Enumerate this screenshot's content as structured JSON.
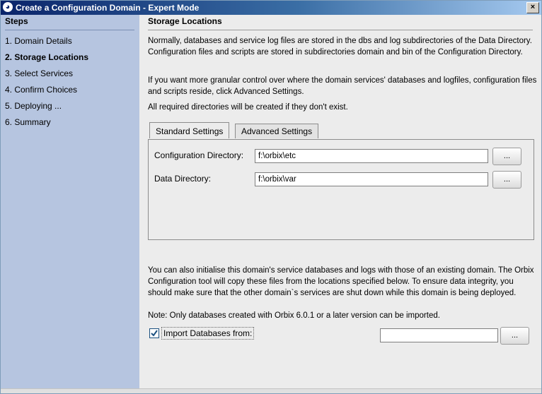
{
  "window": {
    "title": "Create a Configuration Domain - Expert Mode",
    "close_label": "×"
  },
  "sidebar": {
    "header": "Steps",
    "items": [
      {
        "label": "1. Domain Details",
        "active": false
      },
      {
        "label": "2. Storage Locations",
        "active": true
      },
      {
        "label": "3. Select Services",
        "active": false
      },
      {
        "label": "4. Confirm Choices",
        "active": false
      },
      {
        "label": "5. Deploying ...",
        "active": false
      },
      {
        "label": "6. Summary",
        "active": false
      }
    ]
  },
  "main": {
    "title": "Storage Locations",
    "para1": "Normally, databases and service log files are stored in the dbs and log subdirectories of the Data Directory. Configuration files and scripts are stored in subdirectories domain and bin of the Configuration Directory.",
    "para2": "If you want more granular control over where the domain services' databases and logfiles, configuration files and scripts reside, click Advanced Settings.",
    "para3": "All required directories will be created if they don't exist.",
    "tabs": [
      {
        "label": "Standard Settings",
        "active": true
      },
      {
        "label": "Advanced Settings",
        "active": false
      }
    ],
    "fields": {
      "config_dir_label": "Configuration Directory:",
      "config_dir_value": "f:\\orbix\\etc",
      "data_dir_label": "Data Directory:",
      "data_dir_value": "f:\\orbix\\var",
      "browse_label": "..."
    },
    "import_para": "You can also initialise this domain's service databases and logs with those of an existing domain. The Orbix Configuration tool will copy these files from the locations specified below. To ensure data integrity, you should make sure that the other domain`s services are shut down while this domain is being deployed.",
    "import_note": "Note: Only databases created with Orbix 6.0.1 or a later version can be imported.",
    "import_checkbox_label": "Import Databases from:",
    "import_checked": true,
    "import_value": ""
  }
}
